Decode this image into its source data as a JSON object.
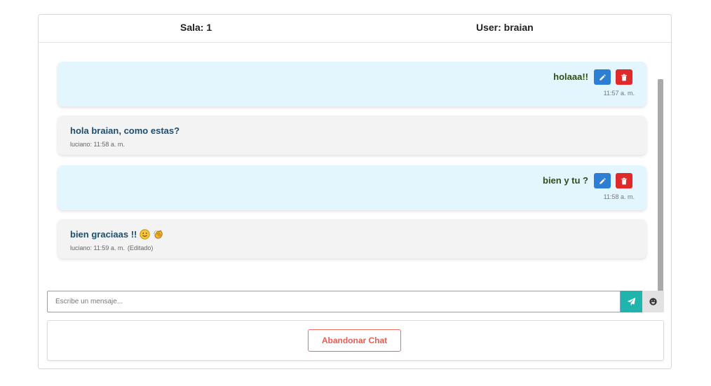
{
  "header": {
    "room_label": "Sala: 1",
    "user_label": "User: braian"
  },
  "messages": [
    {
      "side": "own",
      "text": "holaaa!!",
      "time": "11:57 a. m."
    },
    {
      "side": "other",
      "text": "hola braian, como estas?",
      "meta": "luciano: 11:58 a. m."
    },
    {
      "side": "own",
      "text": "bien y tu ?",
      "time": "11:58 a. m."
    },
    {
      "side": "other",
      "text": "bien graciaas !!",
      "meta": "luciano: 11:59 a. m.",
      "edited": "(Editado)",
      "emojis": [
        "slightly-smiling-face",
        "clapping-hands"
      ]
    }
  ],
  "composer": {
    "placeholder": "Escribe un mensaje..."
  },
  "footer": {
    "leave_label": "Abandonar Chat"
  },
  "colors": {
    "own_bubble": "#e3f5fd",
    "other_bubble": "#f3f3f3",
    "edit_button": "#2d7fd3",
    "delete_button": "#e02a2a",
    "send_button": "#1fb5ac",
    "leave_button": "#ee5b50"
  }
}
